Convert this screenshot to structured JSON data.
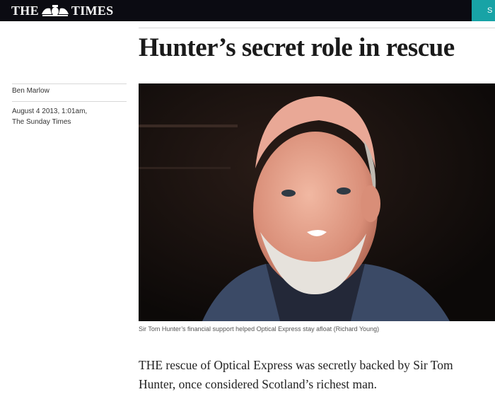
{
  "masthead": {
    "logo_left": "THE",
    "logo_right": "TIMES",
    "subscribe_label": "S"
  },
  "article": {
    "headline": "Hunter’s secret role in rescue",
    "author": "Ben Marlow",
    "date": "August 4 2013, 1:01am,",
    "publication": "The Sunday Times",
    "image_caption": "Sir Tom Hunter’s financial support helped Optical Express stay afloat (Richard Young)",
    "body": "THE rescue of Optical Express was secretly backed by Sir Tom Hunter, once considered Scotland’s richest man."
  },
  "colors": {
    "topbar": "#0b0b12",
    "accent": "#18a3a6",
    "text": "#1a1a1a"
  }
}
